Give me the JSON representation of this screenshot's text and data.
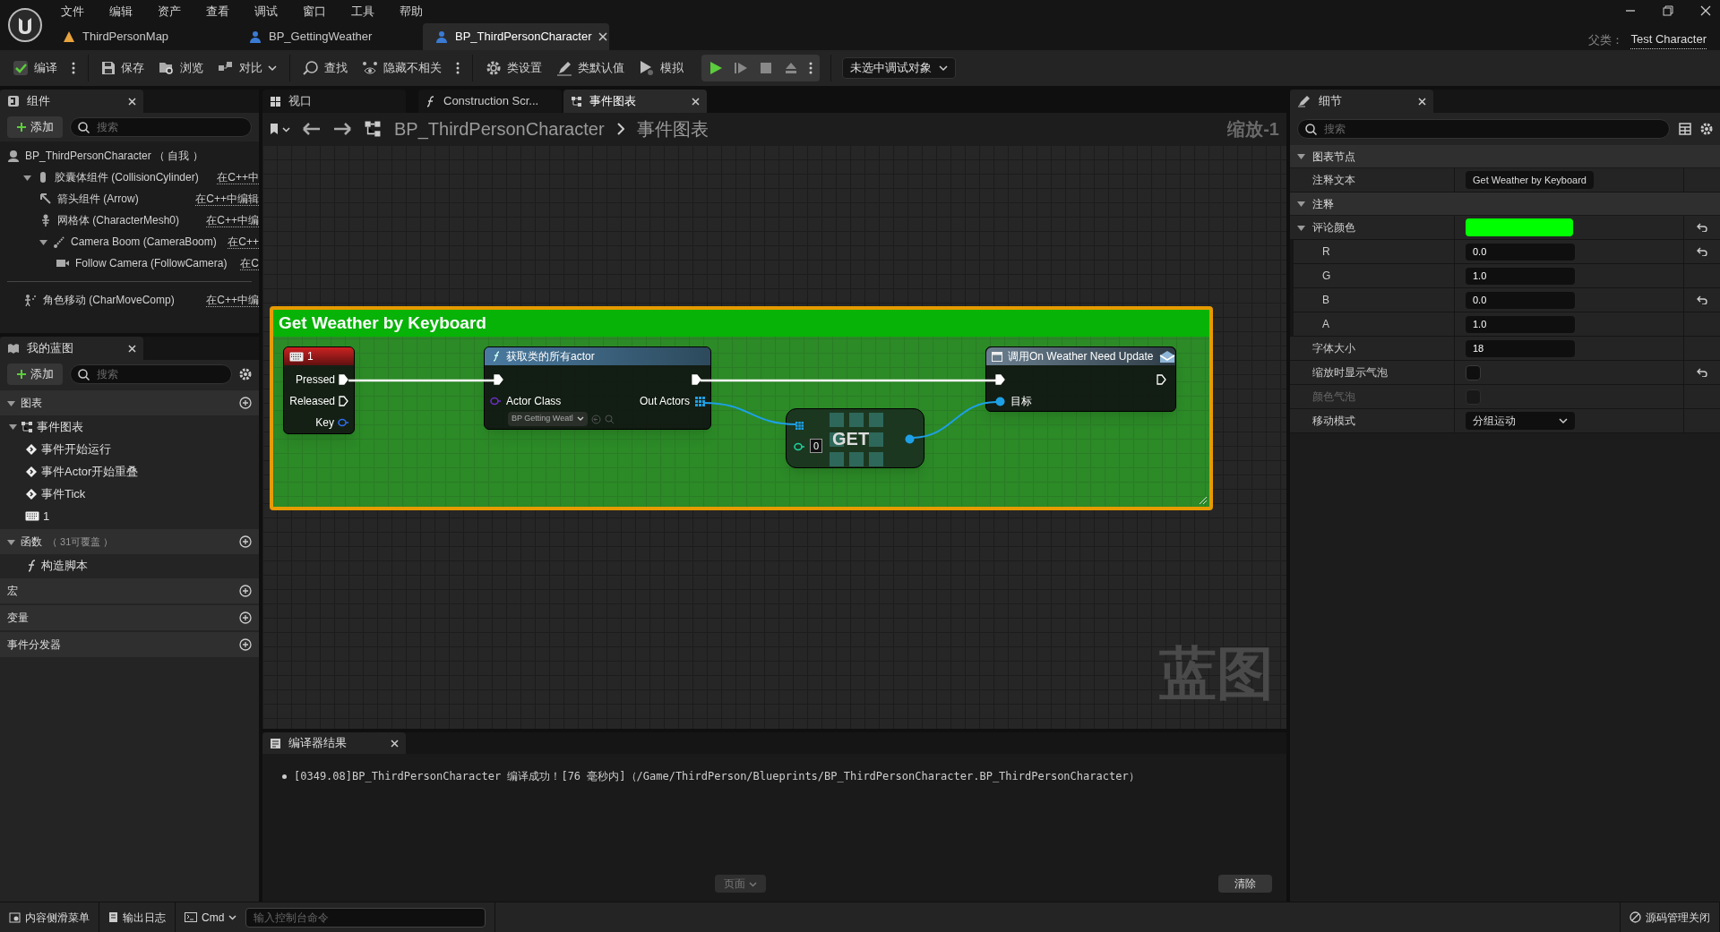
{
  "menu": [
    "文件",
    "编辑",
    "资产",
    "查看",
    "调试",
    "窗口",
    "工具",
    "帮助"
  ],
  "document_tabs": [
    {
      "label": "ThirdPersonMap",
      "kind": "map",
      "selected": false
    },
    {
      "label": "BP_GettingWeather",
      "kind": "blueprint",
      "selected": false
    },
    {
      "label": "BP_ThirdPersonCharacter",
      "kind": "blueprint",
      "selected": true
    }
  ],
  "parent_class": {
    "label": "父类：",
    "value": "Test Character"
  },
  "toolbar": [
    {
      "label": "编译",
      "kind": "compile",
      "more": true
    },
    {
      "label": "保存",
      "kind": "save",
      "more": false
    },
    {
      "label": "浏览",
      "kind": "browse",
      "more": false
    },
    {
      "label": "对比",
      "kind": "diff",
      "more": false
    },
    {
      "label": "查找",
      "kind": "find",
      "more": false
    },
    {
      "label": "隐藏不相关",
      "kind": "hide",
      "more": true
    },
    {
      "label": "类设置",
      "kind": "settings",
      "more": false
    },
    {
      "label": "类默认值",
      "kind": "defaults",
      "more": false
    },
    {
      "label": "模拟",
      "kind": "simulate",
      "more": false
    }
  ],
  "debug_target": "未选中调试对象",
  "components": {
    "title": "组件",
    "add": "添加",
    "search_placeholder": "搜索",
    "tree": [
      {
        "label": "BP_ThirdPersonCharacter （ 自我 ）",
        "kind": "root",
        "children": [
          {
            "label": "胶囊体组件 (CollisionCylinder)",
            "edit": "在C++中",
            "kind": "capsule",
            "expanded": true,
            "children": [
              {
                "label": "箭头组件 (Arrow)",
                "edit": "在C++中编辑",
                "kind": "arrow"
              },
              {
                "label": "网格体 (CharacterMesh0)",
                "edit": "在C++中编",
                "kind": "mesh"
              },
              {
                "label": "Camera Boom (CameraBoom)",
                "edit": "在C++",
                "kind": "boom",
                "expanded": true,
                "children": [
                  {
                    "label": "Follow Camera (FollowCamera)",
                    "edit": "在C",
                    "kind": "camera"
                  }
                ]
              }
            ]
          }
        ]
      }
    ],
    "tree_extra": [
      {
        "label": "角色移动 (CharMoveComp)",
        "edit": "在C++中编",
        "kind": "movement"
      }
    ]
  },
  "my_blueprint": {
    "title": "我的蓝图",
    "add": "添加",
    "search_placeholder": "搜索",
    "sections": [
      {
        "label": "图表",
        "expanded": true,
        "children": [
          {
            "label": "事件图表",
            "kind": "graph",
            "expanded": true,
            "children": [
              {
                "label": "事件开始运行",
                "kind": "event"
              },
              {
                "label": "事件Actor开始重叠",
                "kind": "event"
              },
              {
                "label": "事件Tick",
                "kind": "event"
              },
              {
                "label": "1",
                "kind": "key"
              }
            ]
          }
        ]
      },
      {
        "label": "函数",
        "count": "（ 31可覆盖 ）",
        "expanded": true,
        "children": [
          {
            "label": "构造脚本",
            "kind": "function"
          }
        ]
      },
      {
        "label": "宏"
      },
      {
        "label": "变量"
      },
      {
        "label": "事件分发器"
      }
    ]
  },
  "editor_tabs": [
    {
      "label": "视口",
      "kind": "viewport",
      "selected": false
    },
    {
      "label": "Construction Scr...",
      "kind": "function",
      "selected": false
    },
    {
      "label": "事件图表",
      "kind": "graph",
      "selected": true
    }
  ],
  "graph": {
    "breadcrumb": [
      "BP_ThirdPersonCharacter",
      "事件图表"
    ],
    "zoom": "缩放-1",
    "watermark": "蓝图",
    "comment": "Get Weather by Keyboard",
    "nodes": [
      {
        "kind": "key_event",
        "title": "1",
        "outputs": [
          "Pressed",
          "Released",
          "Key"
        ]
      },
      {
        "kind": "function",
        "title": "获取类的所有actor",
        "input": "Actor Class",
        "input_value": "BP Getting Weatl",
        "output": "Out Actors"
      },
      {
        "kind": "get",
        "title": "GET",
        "index": "0"
      },
      {
        "kind": "call",
        "title": "调用On Weather Need Update",
        "input": "目标"
      }
    ]
  },
  "details": {
    "title": "细节",
    "search_placeholder": "搜索",
    "rows": [
      {
        "kind": "category",
        "label": "图表节点"
      },
      {
        "kind": "text",
        "label": "注释文本",
        "value": "Get Weather by Keyboard"
      },
      {
        "kind": "category",
        "label": "注释"
      },
      {
        "kind": "color",
        "label": "评论颜色",
        "expanded": true,
        "reset": true
      },
      {
        "kind": "number",
        "label": "R",
        "value": "0.0",
        "sub": true,
        "reset": true
      },
      {
        "kind": "number",
        "label": "G",
        "value": "1.0",
        "sub": true,
        "reset": false
      },
      {
        "kind": "number",
        "label": "B",
        "value": "0.0",
        "sub": true,
        "reset": true
      },
      {
        "kind": "number",
        "label": "A",
        "value": "1.0",
        "sub": true,
        "reset": false
      },
      {
        "kind": "number",
        "label": "字体大小",
        "value": "18",
        "reset": false
      },
      {
        "kind": "checkbox",
        "label": "缩放时显示气泡",
        "checked": false,
        "disabled": false,
        "reset": true
      },
      {
        "kind": "checkbox",
        "label": "颜色气泡",
        "checked": false,
        "disabled": true,
        "reset": false
      },
      {
        "kind": "dropdown",
        "label": "移动模式",
        "value": "分组运动",
        "reset": false
      }
    ]
  },
  "compiler": {
    "title": "编译器结果",
    "messages": [
      "[0349.08]BP_ThirdPersonCharacter 编译成功！[76 毫秒内]（/Game/ThirdPerson/Blueprints/BP_ThirdPersonCharacter.BP_ThirdPersonCharacter）"
    ],
    "page": "页面",
    "clear": "清除"
  },
  "status_bar": {
    "content_drawer": "内容侧滑菜单",
    "output_log": "输出日志",
    "cmd": "Cmd",
    "console_placeholder": "输入控制台命令",
    "source_control": "源码管理关闭"
  }
}
